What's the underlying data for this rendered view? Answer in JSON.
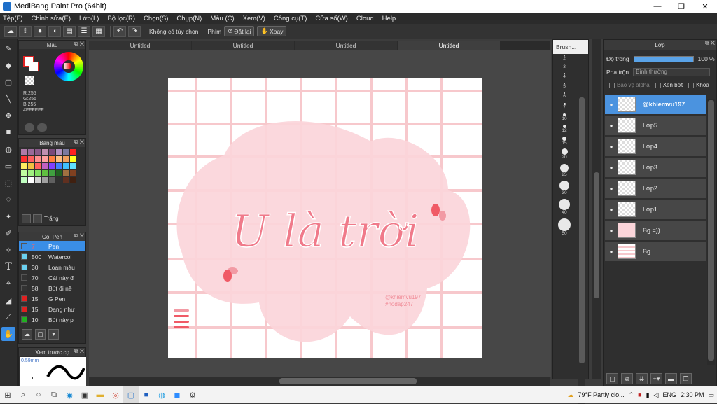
{
  "window": {
    "title": "MediBang Paint Pro (64bit)",
    "controls": [
      "—",
      "❐",
      "✕"
    ]
  },
  "menu": [
    "Tệp(F)",
    "Chỉnh sửa(E)",
    "Lớp(L)",
    "Bộ lọc(R)",
    "Chọn(S)",
    "Chụp(N)",
    "Màu (C)",
    "Xem(V)",
    "Công cụ(T)",
    "Cửa sổ(W)",
    "Cloud",
    "Help"
  ],
  "toolbar": {
    "snap_label": "Không có tùy chọn",
    "key_label": "Phím",
    "reset_label": "Đặt lại",
    "rotate_label": "Xoay"
  },
  "color_panel": {
    "title": "Màu",
    "r": "R:255",
    "g": "G:255",
    "b": "B:255",
    "hex": "#FFFFFF",
    "fg": "#FFFFFF",
    "accent": "#E02020"
  },
  "palette_panel": {
    "title": "Bảng màu",
    "name": "Trắng",
    "colors": [
      "#b07aa8",
      "#9a6a9a",
      "#8a5a8a",
      "#c090b0",
      "#7a4a7a",
      "#b090c0",
      "#7a7aa0",
      "#ff2020",
      "#ff3030",
      "#ff6060",
      "#ff9090",
      "#ffa0a0",
      "#ff8040",
      "#ffc080",
      "#f0a060",
      "#ffff20",
      "#ffee60",
      "#f0c040",
      "#ff6060",
      "#c060c0",
      "#8040ff",
      "#4080ff",
      "#40c0ff",
      "#60e0ff",
      "#c0ffa0",
      "#a0f080",
      "#80e060",
      "#60c040",
      "#40a040",
      "#206020",
      "#a07040",
      "#804020",
      "#c0ffc0",
      "#ffffff",
      "#d0d0d0",
      "#a0a0a0",
      "#606060",
      "#303030",
      "#603020",
      "#402010"
    ]
  },
  "brush_panel": {
    "title": "Cọ: Pen",
    "items": [
      {
        "size": "7",
        "name": "Pen",
        "color": "#3a8ee6"
      },
      {
        "size": "500",
        "name": "Watercol",
        "color": "#6ad0f0"
      },
      {
        "size": "30",
        "name": "Loan màu",
        "color": "#6ad0f0"
      },
      {
        "size": "70",
        "name": "Cái này đ",
        "color": "#333333"
      },
      {
        "size": "58",
        "name": "Bút đi nề",
        "color": "#333333"
      },
      {
        "size": "15",
        "name": "G Pen",
        "color": "#e02020"
      },
      {
        "size": "15",
        "name": "Dạng như",
        "color": "#e02020"
      },
      {
        "size": "10",
        "name": "Bút này p",
        "color": "#20b020"
      }
    ]
  },
  "preview_panel": {
    "title": "Xem trước cọ",
    "size": "0.59mm"
  },
  "tabs": [
    "Untitled",
    "Untitled",
    "Untitled",
    "Untitled"
  ],
  "canvas": {
    "title_text": "U là trời",
    "credit_line1": "@khiemvu197",
    "credit_line2": "#hodap247",
    "colors": {
      "grid": "#f7c8cc",
      "cloud": "#fbd5da",
      "text": "#f07a8a",
      "accent": "#f05a66"
    }
  },
  "brush_sizes": {
    "title": "Brush...",
    "sizes": [
      "2",
      "3",
      "4",
      "5",
      "6",
      "7",
      "10",
      "12",
      "15",
      "20",
      "25",
      "30",
      "40",
      "50"
    ]
  },
  "layers_panel": {
    "title": "Lớp",
    "opacity_label": "Độ trong",
    "opacity_value": "100 %",
    "opacity": 1.0,
    "blend_label": "Pha trộn",
    "blend_value": "Bình thường",
    "protect_alpha": "Bảo vệ alpha",
    "clipping": "Xén bớt",
    "lock": "Khóa",
    "layers": [
      "@khiemvu197",
      "Lớp5",
      "Lớp4",
      "Lớp3",
      "Lớp2",
      "Lớp1",
      "Bg =))",
      "Bg"
    ]
  },
  "taskbar": {
    "weather": "79°F  Partly clo...",
    "lang": "ENG",
    "time": "2:30 PM"
  }
}
